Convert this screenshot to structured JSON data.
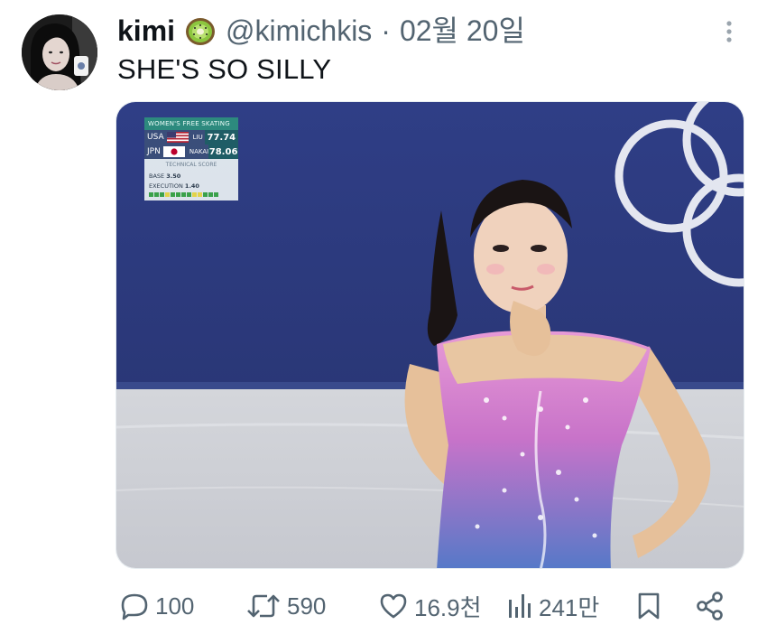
{
  "tweet": {
    "display_name": "kimi",
    "handle": "@kimichkis",
    "separator": "·",
    "date": "02월 20일",
    "text": "SHE'S SO SILLY",
    "badge_icon": "kiwi-icon",
    "more_icon": "more-vertical-icon"
  },
  "media": {
    "scoreboard": {
      "title": "WOMEN'S FREE SKATING",
      "rows": [
        {
          "country": "USA",
          "name": "LIU",
          "score": "77.74"
        },
        {
          "country": "JPN",
          "name": "NAKAI",
          "score": "78.06"
        }
      ],
      "tech_title": "TECHNICAL SCORE",
      "base_label": "BASE",
      "base_value": "3.50",
      "execution_label": "EXECUTION",
      "execution_value": "1.40"
    }
  },
  "actions": {
    "replies": "100",
    "retweets": "590",
    "likes": "16.9천",
    "views": "241만"
  },
  "colors": {
    "text_primary": "#0f1419",
    "text_secondary": "#536471",
    "scoreboard_teal": "#2d8a7e",
    "scoreboard_navy": "#3a4e7a"
  }
}
